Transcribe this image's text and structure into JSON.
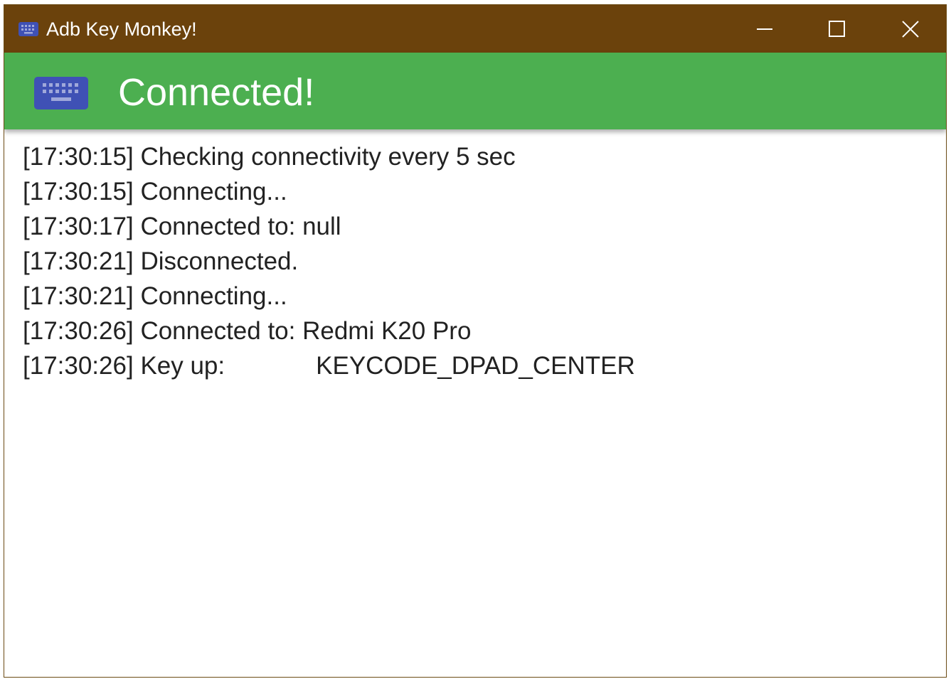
{
  "window": {
    "title": "Adb Key Monkey!",
    "app_icon": "keyboard-icon",
    "controls": {
      "minimize_icon": "minimize-icon",
      "maximize_icon": "maximize-icon",
      "close_icon": "close-icon"
    }
  },
  "header": {
    "icon": "keyboard-icon",
    "status_text": "Connected!"
  },
  "log": {
    "lines": [
      {
        "time": "[17:30:15]",
        "message": "Checking connectivity every 5 sec"
      },
      {
        "time": "[17:30:15]",
        "message": "Connecting..."
      },
      {
        "time": "[17:30:17]",
        "message": "Connected to: null"
      },
      {
        "time": "[17:30:21]",
        "message": "Disconnected."
      },
      {
        "time": "[17:30:21]",
        "message": "Connecting..."
      },
      {
        "time": "[17:30:26]",
        "message": "Connected to: Redmi K20 Pro"
      },
      {
        "time": "[17:30:26]",
        "message": "Key up:",
        "value": "KEYCODE_DPAD_CENTER"
      }
    ]
  },
  "colors": {
    "titlebar": "#6b420c",
    "header": "#4caf50",
    "keyboard_icon": "#3f51b5",
    "log_text": "#222222"
  }
}
